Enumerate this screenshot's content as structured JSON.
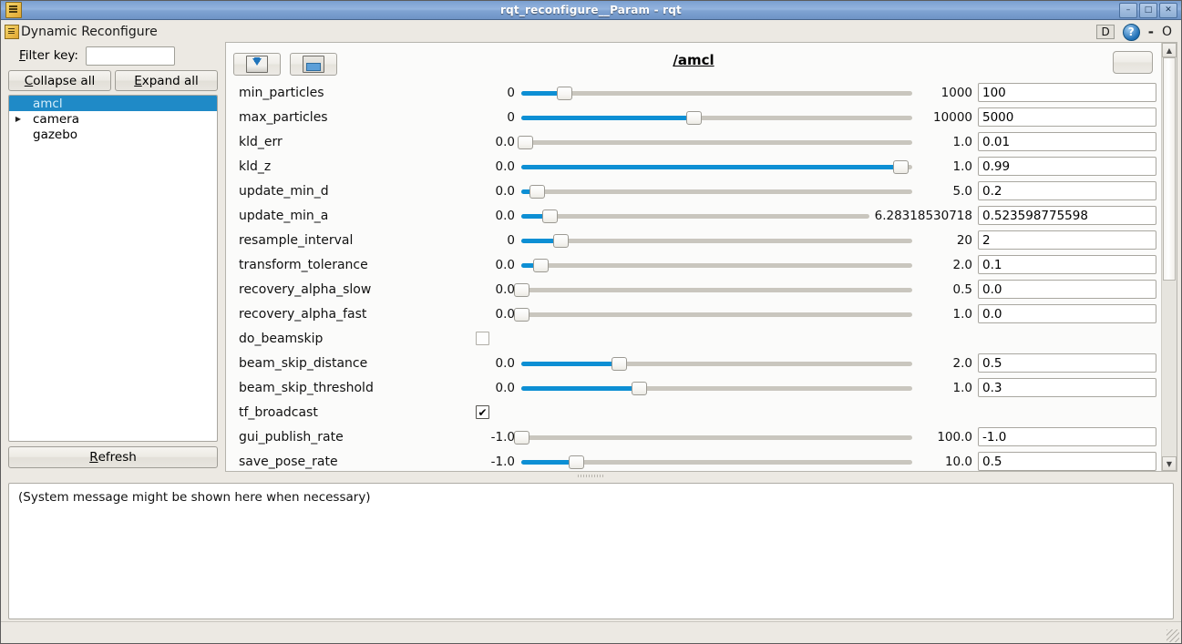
{
  "window": {
    "title": "rqt_reconfigure__Param - rqt",
    "icon": "app-icon",
    "minimize": "–",
    "maximize": "□",
    "close": "✕"
  },
  "plugin": {
    "title": "Dynamic Reconfigure",
    "dock_label": "D",
    "help_label": "?",
    "minimize_label": "-",
    "close_label": "O"
  },
  "sidebar": {
    "filter_label_prefix": "F",
    "filter_label_rest": "ilter key:",
    "filter_value": "",
    "filter_placeholder": "",
    "collapse_prefix": "C",
    "collapse_rest": "ollapse all",
    "expand_prefix": "E",
    "expand_rest": "xpand all",
    "refresh_prefix": "R",
    "refresh_rest": "efresh",
    "tree": [
      {
        "label": "amcl",
        "selected": true,
        "expandable": false
      },
      {
        "label": "camera",
        "selected": false,
        "expandable": true
      },
      {
        "label": "gazebo",
        "selected": false,
        "expandable": false
      }
    ]
  },
  "params_panel": {
    "title": "/amcl",
    "toolbar": [
      {
        "name": "load-config-button",
        "icon": "load-icon"
      },
      {
        "name": "save-config-button",
        "icon": "save-icon"
      }
    ],
    "corner_button_label": "",
    "scrollbar": {
      "up": "▲",
      "down": "▼",
      "thumb_top_pct": 0,
      "thumb_height_pct": 56
    },
    "rows": [
      {
        "name": "min_particles",
        "type": "slider",
        "min": "0",
        "max": "1000",
        "value": "100",
        "fill_pct": 11
      },
      {
        "name": "max_particles",
        "type": "slider",
        "min": "0",
        "max": "10000",
        "value": "5000",
        "fill_pct": 44
      },
      {
        "name": "kld_err",
        "type": "slider",
        "min": "0.0",
        "max": "1.0",
        "value": "0.01",
        "fill_pct": 1
      },
      {
        "name": "kld_z",
        "type": "slider",
        "min": "0.0",
        "max": "1.0",
        "value": "0.99",
        "fill_pct": 97
      },
      {
        "name": "update_min_d",
        "type": "slider",
        "min": "0.0",
        "max": "5.0",
        "value": "0.2",
        "fill_pct": 4
      },
      {
        "name": "update_min_a",
        "type": "slider",
        "min": "0.0",
        "max": "6.28318530718",
        "value": "0.523598775598",
        "fill_pct": 8
      },
      {
        "name": "resample_interval",
        "type": "slider",
        "min": "0",
        "max": "20",
        "value": "2",
        "fill_pct": 10
      },
      {
        "name": "transform_tolerance",
        "type": "slider",
        "min": "0.0",
        "max": "2.0",
        "value": "0.1",
        "fill_pct": 5
      },
      {
        "name": "recovery_alpha_slow",
        "type": "slider",
        "min": "0.0",
        "max": "0.5",
        "value": "0.0",
        "fill_pct": 0
      },
      {
        "name": "recovery_alpha_fast",
        "type": "slider",
        "min": "0.0",
        "max": "1.0",
        "value": "0.0",
        "fill_pct": 0
      },
      {
        "name": "do_beamskip",
        "type": "checkbox",
        "checked": false
      },
      {
        "name": "beam_skip_distance",
        "type": "slider",
        "min": "0.0",
        "max": "2.0",
        "value": "0.5",
        "fill_pct": 25
      },
      {
        "name": "beam_skip_threshold",
        "type": "slider",
        "min": "0.0",
        "max": "1.0",
        "value": "0.3",
        "fill_pct": 30
      },
      {
        "name": "tf_broadcast",
        "type": "checkbox",
        "checked": true
      },
      {
        "name": "gui_publish_rate",
        "type": "slider",
        "min": "-1.0",
        "max": "100.0",
        "value": "-1.0",
        "fill_pct": 0
      },
      {
        "name": "save_pose_rate",
        "type": "slider",
        "min": "-1.0",
        "max": "10.0",
        "value": "0.5",
        "fill_pct": 14
      }
    ]
  },
  "message_area": {
    "text": "(System message might be shown here when necessary)"
  },
  "statusbar": {
    "text": ""
  },
  "colors": {
    "accent_blue": "#0d8fd4",
    "selection_blue": "#1f8ac7",
    "window_bg": "#ece9e3",
    "panel_bg": "#fbfbfa"
  }
}
